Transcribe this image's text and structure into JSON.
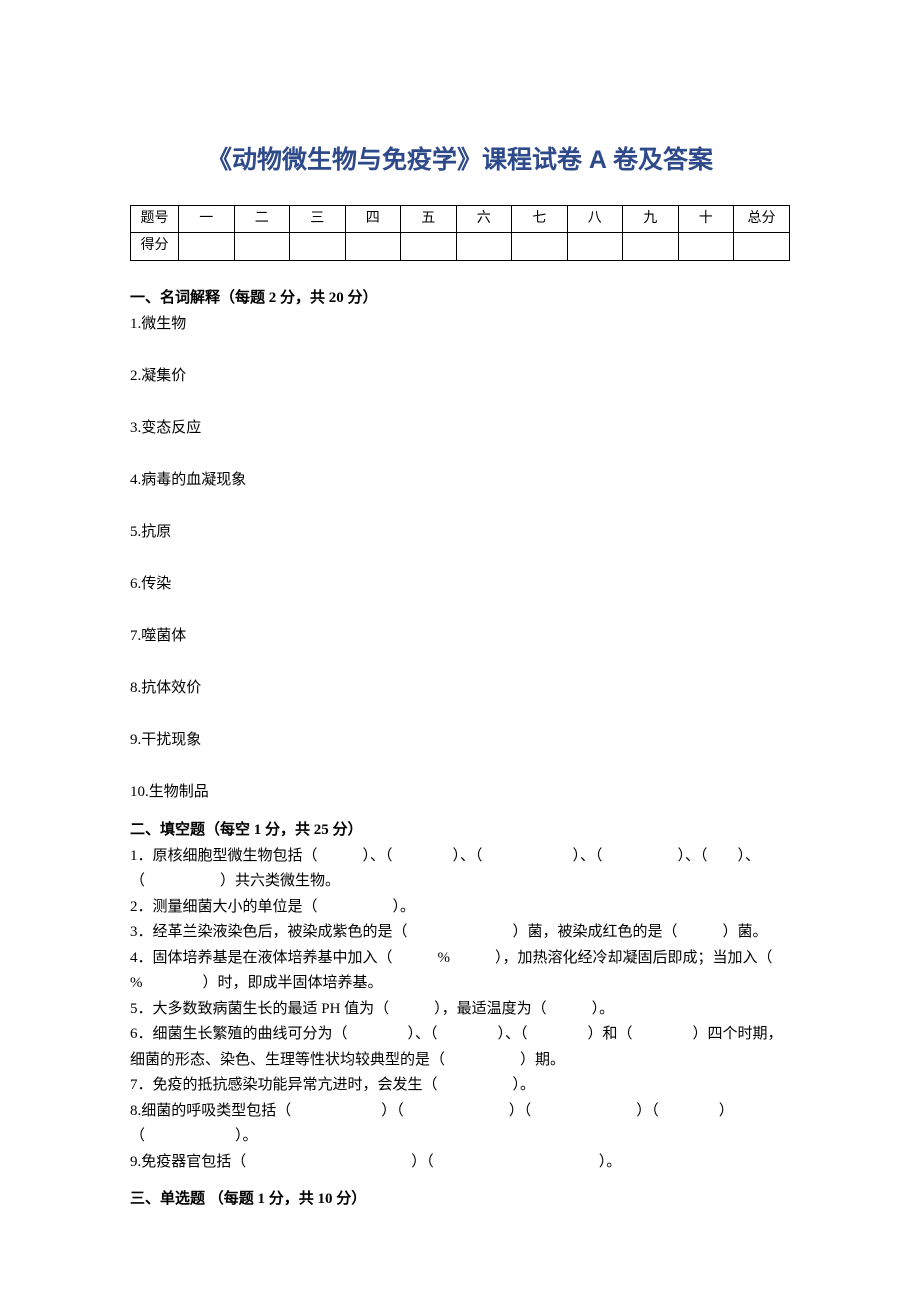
{
  "title": "《动物微生物与免疫学》课程试卷 A 卷及答案",
  "scoreTable": {
    "row1": [
      "题号",
      "一",
      "二",
      "三",
      "四",
      "五",
      "六",
      "七",
      "八",
      "九",
      "十",
      "总分"
    ],
    "row2Label": "得分"
  },
  "section1": {
    "header": "一、名词解释（每题 2 分，共 20 分）",
    "items": [
      "1.微生物",
      "2.凝集价",
      "3.变态反应",
      "4.病毒的血凝现象",
      "5.抗原",
      "6.传染",
      "7.噬菌体",
      "8.抗体效价",
      "9.干扰现象",
      "10.生物制品"
    ]
  },
  "section2": {
    "header": "二、填空题（每空 1 分，共 25 分）",
    "items": [
      "1．原核细胞型微生物包括（　　　）、（　　　　）、（　　　　　　）、（　　　　　）、（　　）、（　　　　　）共六类微生物。",
      "2．测量细菌大小的单位是（　　　　　）。",
      "3．经革兰染液染色后，被染成紫色的是（　　　　　　　）菌，被染成红色的是（　　　）菌。",
      "4．固体培养基是在液体培养基中加入（　　　%　　　），加热溶化经冷却凝固后即成；当加入（　　　%　　　　）时，即成半固体培养基。",
      "5．大多数致病菌生长的最适 PH 值为（　　　），最适温度为（　　　）。",
      "6．细菌生长繁殖的曲线可分为（　　　　）、（　　　　）、（　　　　）和（　　　　）四个时期，细菌的形态、染色、生理等性状均较典型的是（　　　　　）期。",
      "7．免疫的抵抗感染功能异常亢进时，会发生（　　　　　）。",
      "8.细菌的呼吸类型包括（　　　　　　）（　　　　　　　）（　　　　　　　）（　　　　）（　　　　　　）。",
      "9.免疫器官包括（　　　　　　　　　　　）（　　　　　　　　　　　）。"
    ]
  },
  "section3": {
    "header": "三、单选题 （每题 1 分，共 10 分）"
  }
}
